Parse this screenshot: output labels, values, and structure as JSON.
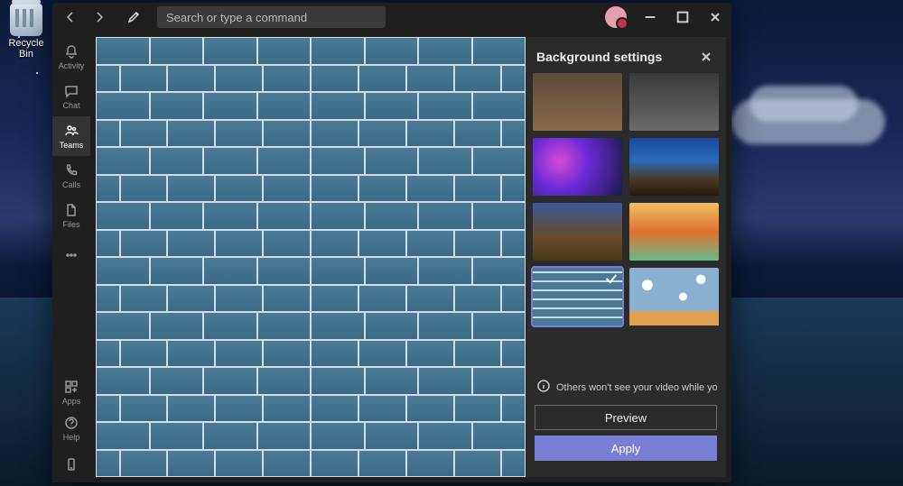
{
  "desktop": {
    "recycle_bin": "Recycle Bin"
  },
  "titlebar": {
    "search_placeholder": "Search or type a command"
  },
  "rail": {
    "items": [
      {
        "label": "Activity",
        "icon": "bell-icon"
      },
      {
        "label": "Chat",
        "icon": "chat-icon"
      },
      {
        "label": "Teams",
        "icon": "teams-icon",
        "active": true
      },
      {
        "label": "Calls",
        "icon": "phone-icon"
      },
      {
        "label": "Files",
        "icon": "file-icon"
      },
      {
        "label": "",
        "icon": "more-icon"
      }
    ],
    "bottom": [
      {
        "label": "Apps",
        "icon": "apps-icon"
      },
      {
        "label": "Help",
        "icon": "help-icon"
      },
      {
        "label": "",
        "icon": "device-icon"
      }
    ]
  },
  "panel": {
    "title": "Background settings",
    "info_text": "Others won't see your video while you previe...",
    "preview_label": "Preview",
    "apply_label": "Apply",
    "thumbs": [
      {
        "name": "bg-street",
        "cls": "tb-street"
      },
      {
        "name": "bg-mech",
        "cls": "tb-mech"
      },
      {
        "name": "bg-nebula",
        "cls": "tb-nebula"
      },
      {
        "name": "bg-planet",
        "cls": "tb-planet"
      },
      {
        "name": "bg-alley",
        "cls": "tb-alley"
      },
      {
        "name": "bg-sunset",
        "cls": "tb-sunset"
      },
      {
        "name": "bg-brick",
        "cls": "tb-brick",
        "selected": true
      },
      {
        "name": "bg-clouds",
        "cls": "tb-clouds"
      }
    ]
  }
}
